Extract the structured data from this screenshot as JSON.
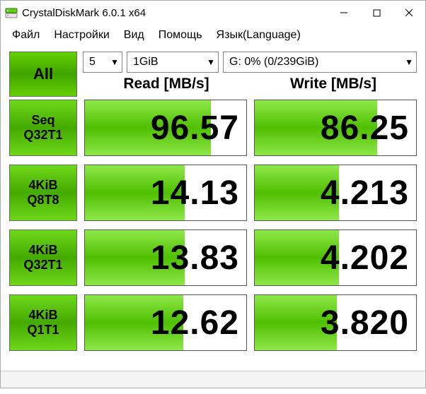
{
  "window": {
    "title": "CrystalDiskMark 6.0.1 x64"
  },
  "menubar": {
    "file": "Файл",
    "settings": "Настройки",
    "view": "Вид",
    "help": "Помощь",
    "language": "Язык(Language)"
  },
  "controls": {
    "all_label": "All",
    "count_value": "5",
    "size_value": "1GiB",
    "drive_value": "G: 0% (0/239GiB)"
  },
  "headers": {
    "read": "Read [MB/s]",
    "write": "Write [MB/s]"
  },
  "rows": [
    {
      "label1": "Seq",
      "label2": "Q32T1",
      "read": "96.57",
      "write": "86.25",
      "read_fill": 78,
      "write_fill": 76
    },
    {
      "label1": "4KiB",
      "label2": "Q8T8",
      "read": "14.13",
      "write": "4.213",
      "read_fill": 62,
      "write_fill": 52
    },
    {
      "label1": "4KiB",
      "label2": "Q32T1",
      "read": "13.83",
      "write": "4.202",
      "read_fill": 62,
      "write_fill": 52
    },
    {
      "label1": "4KiB",
      "label2": "Q1T1",
      "read": "12.62",
      "write": "3.820",
      "read_fill": 61,
      "write_fill": 51
    }
  ]
}
